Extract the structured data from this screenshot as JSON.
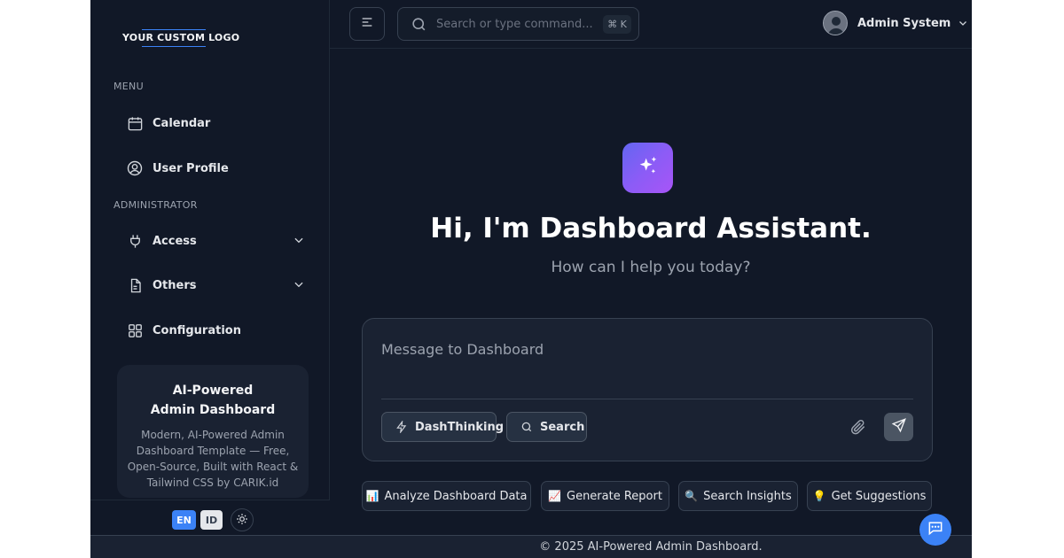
{
  "brand": {
    "logo_text": "YOUR CUSTOM LOGO"
  },
  "sidebar": {
    "menu_label": "MENU",
    "admin_label": "ADMINISTRATOR",
    "items": [
      {
        "label": "Calendar",
        "icon": "calendar-icon"
      },
      {
        "label": "User Profile",
        "icon": "user-circle-icon"
      },
      {
        "label": "Access",
        "icon": "plug-icon",
        "expandable": true
      },
      {
        "label": "Others",
        "icon": "document-icon",
        "expandable": true
      },
      {
        "label": "Configuration",
        "icon": "grid-icon"
      }
    ],
    "promo": {
      "title_line1": "AI-Powered",
      "title_line2": "Admin Dashboard",
      "description": "Modern, AI-Powered Admin Dashboard Template — Free, Open-Source, Built with React & Tailwind CSS by CARIK.id"
    },
    "languages": [
      {
        "code": "EN",
        "active": true
      },
      {
        "code": "ID",
        "active": false
      }
    ]
  },
  "header": {
    "search_placeholder": "Search or type command...",
    "shortcut": "⌘ K",
    "user_name": "Admin System"
  },
  "assistant": {
    "greeting": "Hi, I'm Dashboard Assistant.",
    "subtitle": "How can I help you today?",
    "message_placeholder": "Message to Dashboard",
    "dashthinking_label": "DashThinking",
    "search_label": "Search"
  },
  "suggestions": [
    {
      "emoji": "📊",
      "label": "Analyze Dashboard Data"
    },
    {
      "emoji": "📈",
      "label": "Generate Report"
    },
    {
      "emoji": "🔍",
      "label": "Search Insights"
    },
    {
      "emoji": "💡",
      "label": "Get Suggestions"
    }
  ],
  "footer": {
    "text": "© 2025 AI-Powered Admin Dashboard."
  },
  "colors": {
    "background": "#111827",
    "panel": "#1a2232",
    "border": "#374151",
    "accent": "#3b82f6",
    "gradient_start": "#6366f1",
    "gradient_end": "#a855f7"
  }
}
